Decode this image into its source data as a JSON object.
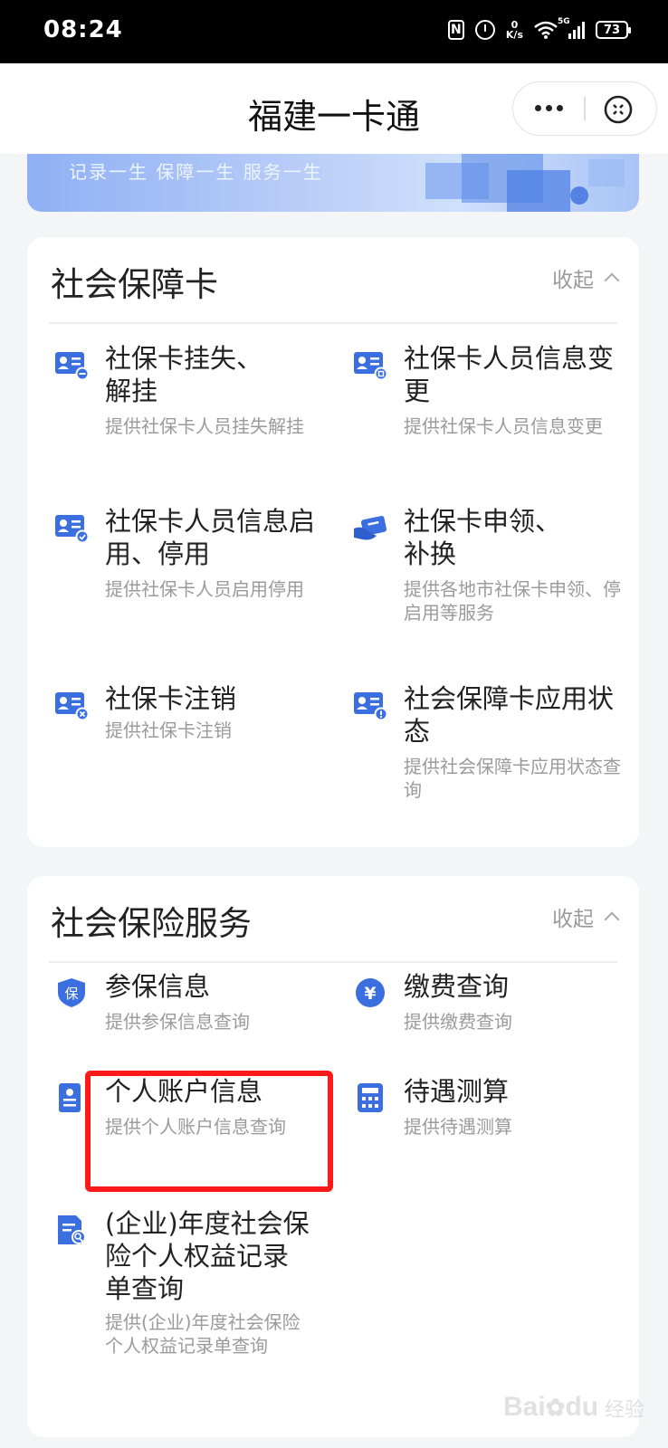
{
  "status_bar": {
    "time": "08:24",
    "nfc": "N",
    "speed_value": "0",
    "speed_unit": "K/s",
    "network": "5G",
    "battery": "73"
  },
  "nav": {
    "title": "福建一卡通"
  },
  "banner": {
    "slogan": "记录一生  保障一生  服务一生"
  },
  "card_social_security_card": {
    "title": "社会保障卡",
    "collapse_label": "收起",
    "items": [
      {
        "title": "社保卡挂失、\n解挂",
        "desc": "提供社保卡人员挂失解挂",
        "icon": "id-card-minus-icon"
      },
      {
        "title": "社保卡人员信息变更",
        "desc": "提供社保卡人员信息变更",
        "icon": "id-card-edit-icon"
      },
      {
        "title": "社保卡人员信息启用、停用",
        "desc": "提供社保卡人员启用停用",
        "icon": "id-card-check-icon"
      },
      {
        "title": "社保卡申领、\n补换",
        "desc": "提供各地市社保卡申领、停启用等服务",
        "icon": "card-hand-icon"
      },
      {
        "title": "社保卡注销",
        "desc": "提供社保卡注销",
        "icon": "id-card-cancel-icon"
      },
      {
        "title": "社会保障卡应用状态",
        "desc": "提供社会保障卡应用状态查询",
        "icon": "id-card-alert-icon"
      }
    ]
  },
  "card_social_insurance": {
    "title": "社会保险服务",
    "collapse_label": "收起",
    "items": [
      {
        "title": "参保信息",
        "desc": "提供参保信息查询",
        "icon": "shield-bao-icon",
        "icon_text": "保"
      },
      {
        "title": "缴费查询",
        "desc": "提供缴费查询",
        "icon": "yuan-coin-icon",
        "icon_text": "¥"
      },
      {
        "title": "个人账户信息",
        "desc": "提供个人账户信息查询",
        "icon": "personal-account-icon"
      },
      {
        "title": "待遇测算",
        "desc": "提供待遇测算",
        "icon": "calculator-icon"
      },
      {
        "title": "(企业)年度社会保险个人权益记录单查询",
        "desc": "提供(企业)年度社会保险个人权益记录单查询",
        "icon": "document-search-icon"
      }
    ]
  },
  "watermark": {
    "brand": "Bai",
    "brand2": "du",
    "suffix": "经验"
  },
  "colors": {
    "accent": "#3b6fe0",
    "highlight": "#ff1a1a"
  }
}
